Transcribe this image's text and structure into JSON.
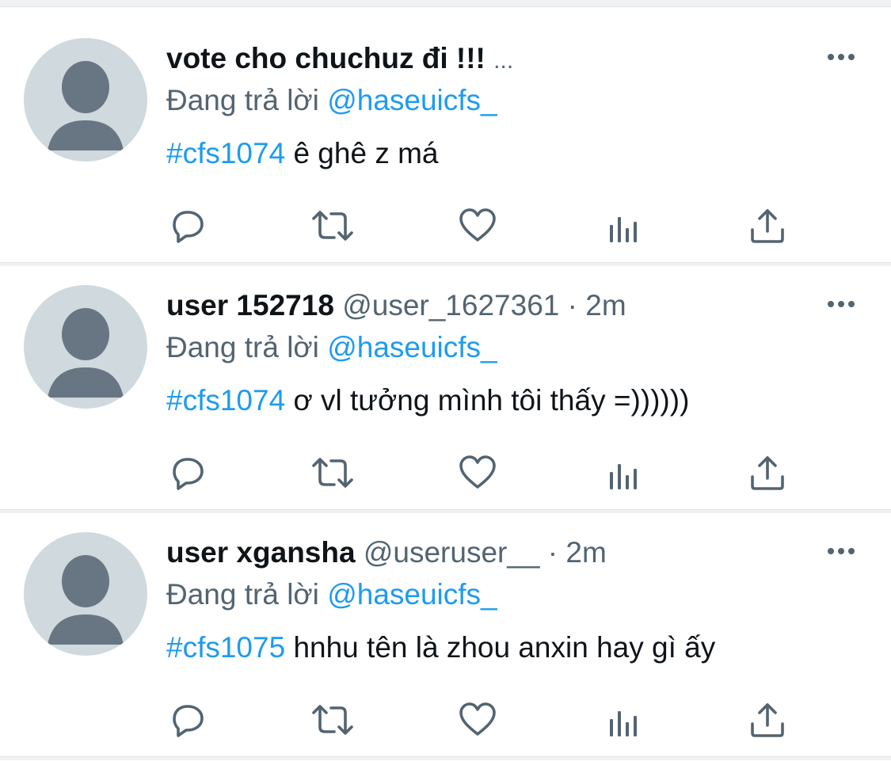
{
  "tweets": [
    {
      "name": "vote cho chuchuz đi !!!",
      "truncated": "...",
      "handle": "",
      "dot": "",
      "time": "",
      "replying_prefix": "Đang trả lời",
      "replying_to": "@haseuicfs_",
      "hashtag": "#cfs1074",
      "text": "ê ghê z má",
      "avatar_icon": "default-user-avatar-icon",
      "more_icon": "more-options-icon",
      "actions": [
        "reply-icon",
        "retweet-icon",
        "like-icon",
        "views-icon",
        "share-icon"
      ]
    },
    {
      "name": "user 152718",
      "truncated": "",
      "handle": "@user_1627361",
      "dot": "·",
      "time": "2m",
      "replying_prefix": "Đang trả lời",
      "replying_to": "@haseuicfs_",
      "hashtag": "#cfs1074",
      "text": "ơ vl tưởng mình tôi thấy =))))))",
      "avatar_icon": "default-user-avatar-icon",
      "more_icon": "more-options-icon",
      "actions": [
        "reply-icon",
        "retweet-icon",
        "like-icon",
        "views-icon",
        "share-icon"
      ]
    },
    {
      "name": "user xgansha",
      "truncated": "",
      "handle": "@useruser__",
      "dot": "·",
      "time": "2m",
      "replying_prefix": "Đang trả lời",
      "replying_to": "@haseuicfs_",
      "hashtag": "#cfs1075",
      "text": "hnhu tên là zhou anxin hay gì ấy",
      "avatar_icon": "default-user-avatar-icon",
      "more_icon": "more-options-icon",
      "actions": [
        "reply-icon",
        "retweet-icon",
        "like-icon",
        "views-icon",
        "share-icon"
      ]
    }
  ],
  "colors": {
    "link": "#1d9bf0",
    "secondary_text": "#536471",
    "primary_text": "#0f1419",
    "avatar_bg": "#cfd9de",
    "avatar_fg": "#687684",
    "icon": "#536471",
    "divider": "#eff1f3"
  }
}
